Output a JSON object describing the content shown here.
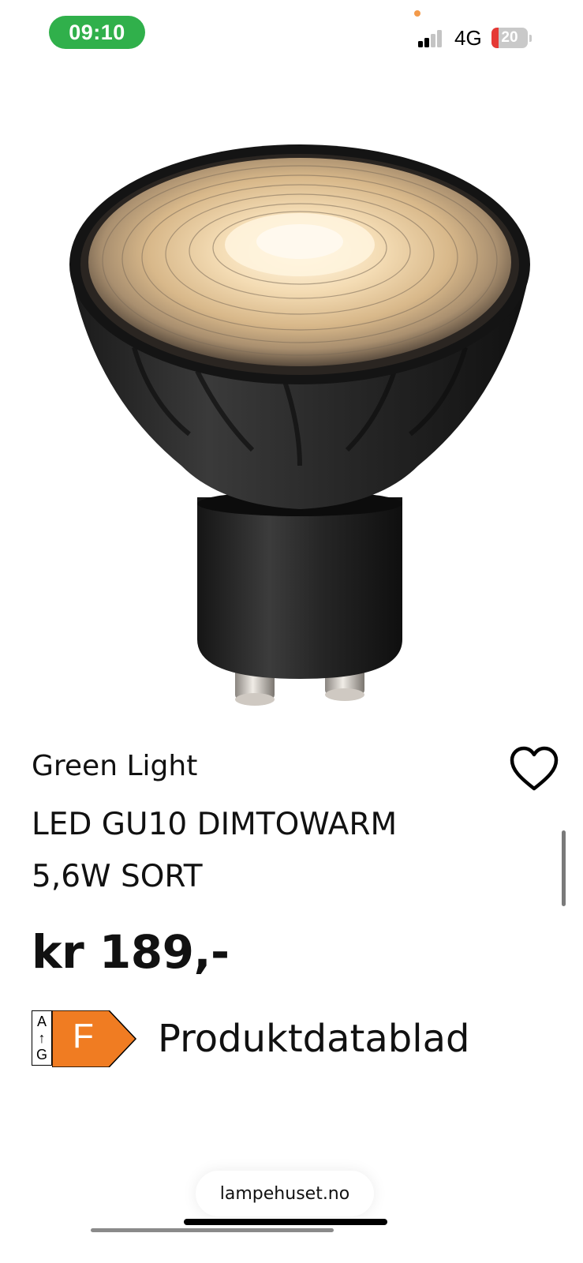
{
  "status_bar": {
    "time": "09:10",
    "network": "4G",
    "battery": "20",
    "battery_level": 0.2,
    "signal_bars_active": 2,
    "signal_bars_total": 4,
    "colors": {
      "time_pill": "#30b04b",
      "battery_low": "#e53935",
      "privacy_dot": "#f39a4a"
    }
  },
  "product": {
    "image_icon": "gu10-led-bulb-image",
    "brand": "Green Light",
    "title_line1": "LED GU10 DIMTOWARM",
    "title_line2": "5,6W SORT",
    "price": "kr 189,-",
    "favorite_icon": "heart-outline-icon"
  },
  "energy_label": {
    "scale_top": "A",
    "scale_arrow": "↑",
    "scale_bottom": "G",
    "energy_class": "F",
    "class_color": "#f07c22",
    "datasheet_text": "Produktdatablad"
  },
  "browser": {
    "url": "lampehuset.no"
  }
}
